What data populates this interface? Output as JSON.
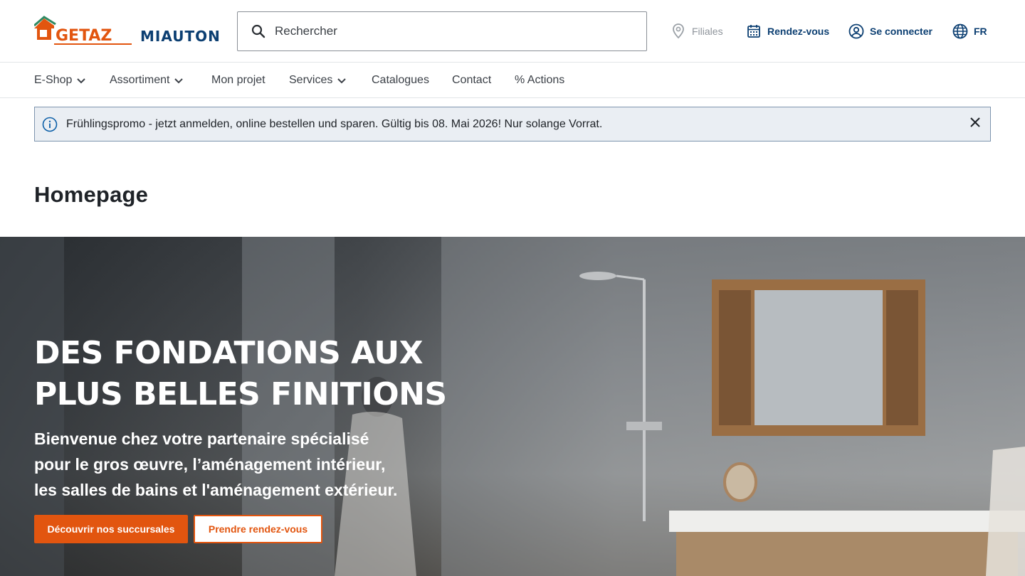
{
  "brand": {
    "logo_left": "GETAZ",
    "logo_right": "MIAUTON",
    "accent_color": "#e2550f",
    "navy_color": "#0c3f72"
  },
  "search": {
    "placeholder": "Rechercher",
    "icon": "search-icon"
  },
  "utility": {
    "filiales": "Filiales",
    "rendezvous": "Rendez-vous",
    "login": "Se connecter",
    "language": "FR"
  },
  "nav": {
    "items": [
      {
        "label": "E-Shop",
        "has_dropdown": true
      },
      {
        "label": "Assortiment",
        "has_dropdown": true
      },
      {
        "label": "Mon projet",
        "has_dropdown": false
      },
      {
        "label": "Services",
        "has_dropdown": true
      },
      {
        "label": "Catalogues",
        "has_dropdown": false
      },
      {
        "label": "Contact",
        "has_dropdown": false
      },
      {
        "label": "% Actions",
        "has_dropdown": false
      }
    ]
  },
  "banner": {
    "message": "Frühlingspromo - jetzt anmelden, online bestellen und sparen. Gültig bis 08. Mai 2026! Nur solange Vorrat."
  },
  "page": {
    "title": "Homepage"
  },
  "hero": {
    "title_line1": "DES FONDATIONS AUX",
    "title_line2": "PLUS BELLES FINITIONS",
    "subtitle_line1": "Bienvenue chez votre partenaire spécialisé",
    "subtitle_line2": "pour le gros œuvre, l’aménagement intérieur,",
    "subtitle_line3": "les salles de bains et l'aménagement extérieur.",
    "primary_button": "Découvrir nos succursales",
    "secondary_button": "Prendre rendez-vous"
  }
}
